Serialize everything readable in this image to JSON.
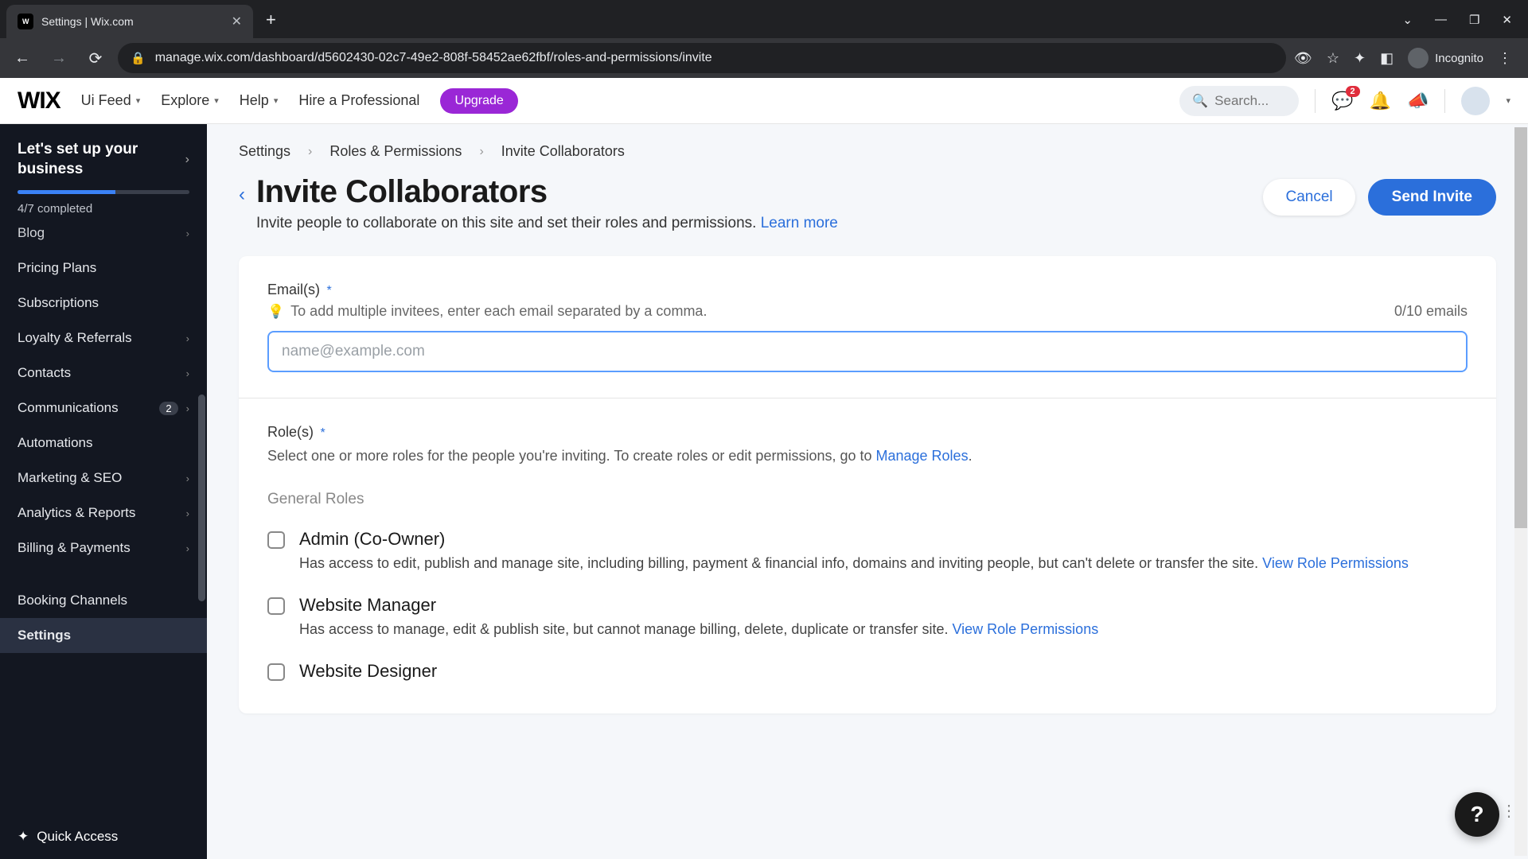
{
  "browser": {
    "tab_title": "Settings | Wix.com",
    "url": "manage.wix.com/dashboard/d5602430-02c7-49e2-808f-58452ae62fbf/roles-and-permissions/invite",
    "incognito_label": "Incognito"
  },
  "topnav": {
    "logo": "WIX",
    "site_switcher": "Ui Feed",
    "items": [
      "Explore",
      "Help",
      "Hire a Professional"
    ],
    "upgrade": "Upgrade",
    "search_placeholder": "Search...",
    "inbox_badge": "2"
  },
  "sidebar": {
    "setup_title": "Let's set up your business",
    "completed": "4/7 completed",
    "items": [
      {
        "label": "Blog",
        "chevron": true,
        "cut": true
      },
      {
        "label": "Pricing Plans"
      },
      {
        "label": "Subscriptions"
      },
      {
        "label": "Loyalty & Referrals",
        "chevron": true
      },
      {
        "label": "Contacts",
        "chevron": true
      },
      {
        "label": "Communications",
        "chevron": true,
        "badge": "2"
      },
      {
        "label": "Automations"
      },
      {
        "label": "Marketing & SEO",
        "chevron": true
      },
      {
        "label": "Analytics & Reports",
        "chevron": true
      },
      {
        "label": "Billing & Payments",
        "chevron": true
      },
      {
        "label": "Booking Channels"
      },
      {
        "label": "Settings",
        "active": true
      }
    ],
    "quick_access": "Quick Access"
  },
  "breadcrumbs": [
    "Settings",
    "Roles & Permissions",
    "Invite Collaborators"
  ],
  "header": {
    "title": "Invite Collaborators",
    "subtitle": "Invite people to collaborate on this site and set their roles and permissions. ",
    "learn_more": "Learn more",
    "cancel": "Cancel",
    "send": "Send Invite"
  },
  "email": {
    "label": "Email(s)",
    "hint": "To add multiple invitees, enter each email separated by a comma.",
    "counter": "0/10 emails",
    "placeholder": "name@example.com"
  },
  "roles": {
    "label": "Role(s)",
    "sub_prefix": "Select one or more roles for the people you're inviting. To create roles or edit permissions, go to ",
    "manage_link": "Manage Roles",
    "group": "General Roles",
    "view_perm": "View Role Permissions",
    "list": [
      {
        "name": "Admin (Co-Owner)",
        "desc": "Has access to edit, publish and manage site, including billing, payment & financial info, domains and inviting people, but can't delete or transfer the site.  "
      },
      {
        "name": "Website Manager",
        "desc": "Has access to manage, edit & publish site, but cannot manage billing, delete, duplicate or transfer site.  "
      },
      {
        "name": "Website Designer",
        "desc": ""
      }
    ]
  }
}
